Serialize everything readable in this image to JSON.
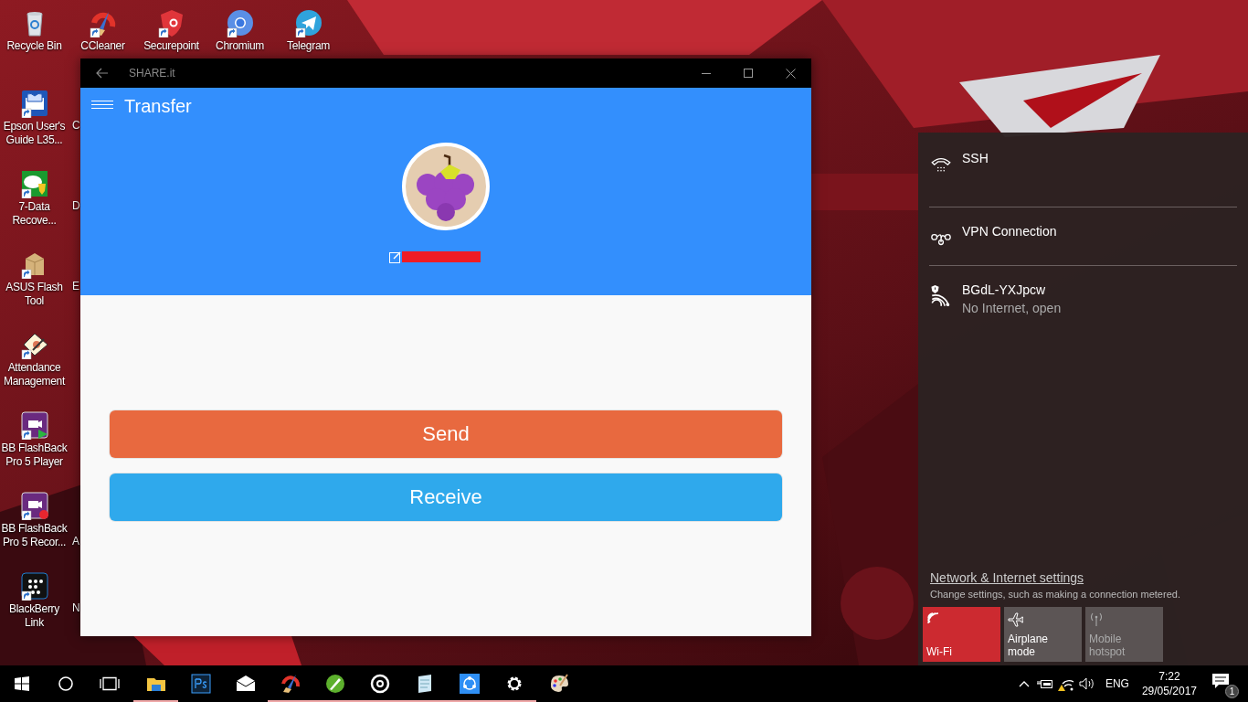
{
  "desktop_icons": [
    {
      "label": "Recycle Bin"
    },
    {
      "label": "CCleaner"
    },
    {
      "label": "Securepoint"
    },
    {
      "label": "Chromium"
    },
    {
      "label": "Telegram"
    },
    {
      "label": "Epson User's Guide L35..."
    },
    {
      "label": "7-Data Recove..."
    },
    {
      "label": "ASUS Flash Tool"
    },
    {
      "label": "Attendance Management"
    },
    {
      "label": "BB FlashBack Pro 5 Player"
    },
    {
      "label": "BB FlashBack Pro 5 Recor..."
    },
    {
      "label": "BlackBerry Link"
    }
  ],
  "hidden_icon_labels": [
    {
      "label": "C"
    },
    {
      "label": "D"
    },
    {
      "label": "E"
    },
    {
      "label": "A"
    },
    {
      "label": "N"
    }
  ],
  "window": {
    "title": "SHARE.it",
    "page_title": "Transfer",
    "buttons": [
      {
        "label": "Send",
        "kind": "send"
      },
      {
        "label": "Receive",
        "kind": "receive"
      }
    ]
  },
  "network_panel": {
    "connections": [
      {
        "kind": "dialup",
        "name": "SSH"
      },
      {
        "kind": "vpn",
        "name": "VPN Connection"
      },
      {
        "kind": "wifi",
        "name": "BGdL-YXJpcw",
        "status": "No Internet, open"
      }
    ],
    "settings_link": "Network & Internet settings",
    "settings_hint": "Change settings, such as making a connection metered.",
    "quick_actions": [
      {
        "kind": "wifi",
        "label": "Wi-Fi",
        "on": true,
        "disabled": false
      },
      {
        "kind": "airplane",
        "label": "Airplane mode",
        "on": false,
        "disabled": false
      },
      {
        "kind": "hotspot",
        "label": "Mobile hotspot",
        "on": false,
        "disabled": true
      }
    ]
  },
  "taskbar": {
    "apps": [
      {
        "running": true
      },
      {
        "running": false
      },
      {
        "running": false
      },
      {
        "running": true
      },
      {
        "running": true
      },
      {
        "running": true
      },
      {
        "running": true
      },
      {
        "running": true
      },
      {
        "running": true
      },
      {
        "running": false
      }
    ],
    "language": "ENG",
    "time": "7:22",
    "date": "29/05/2017",
    "notifications": "1"
  }
}
